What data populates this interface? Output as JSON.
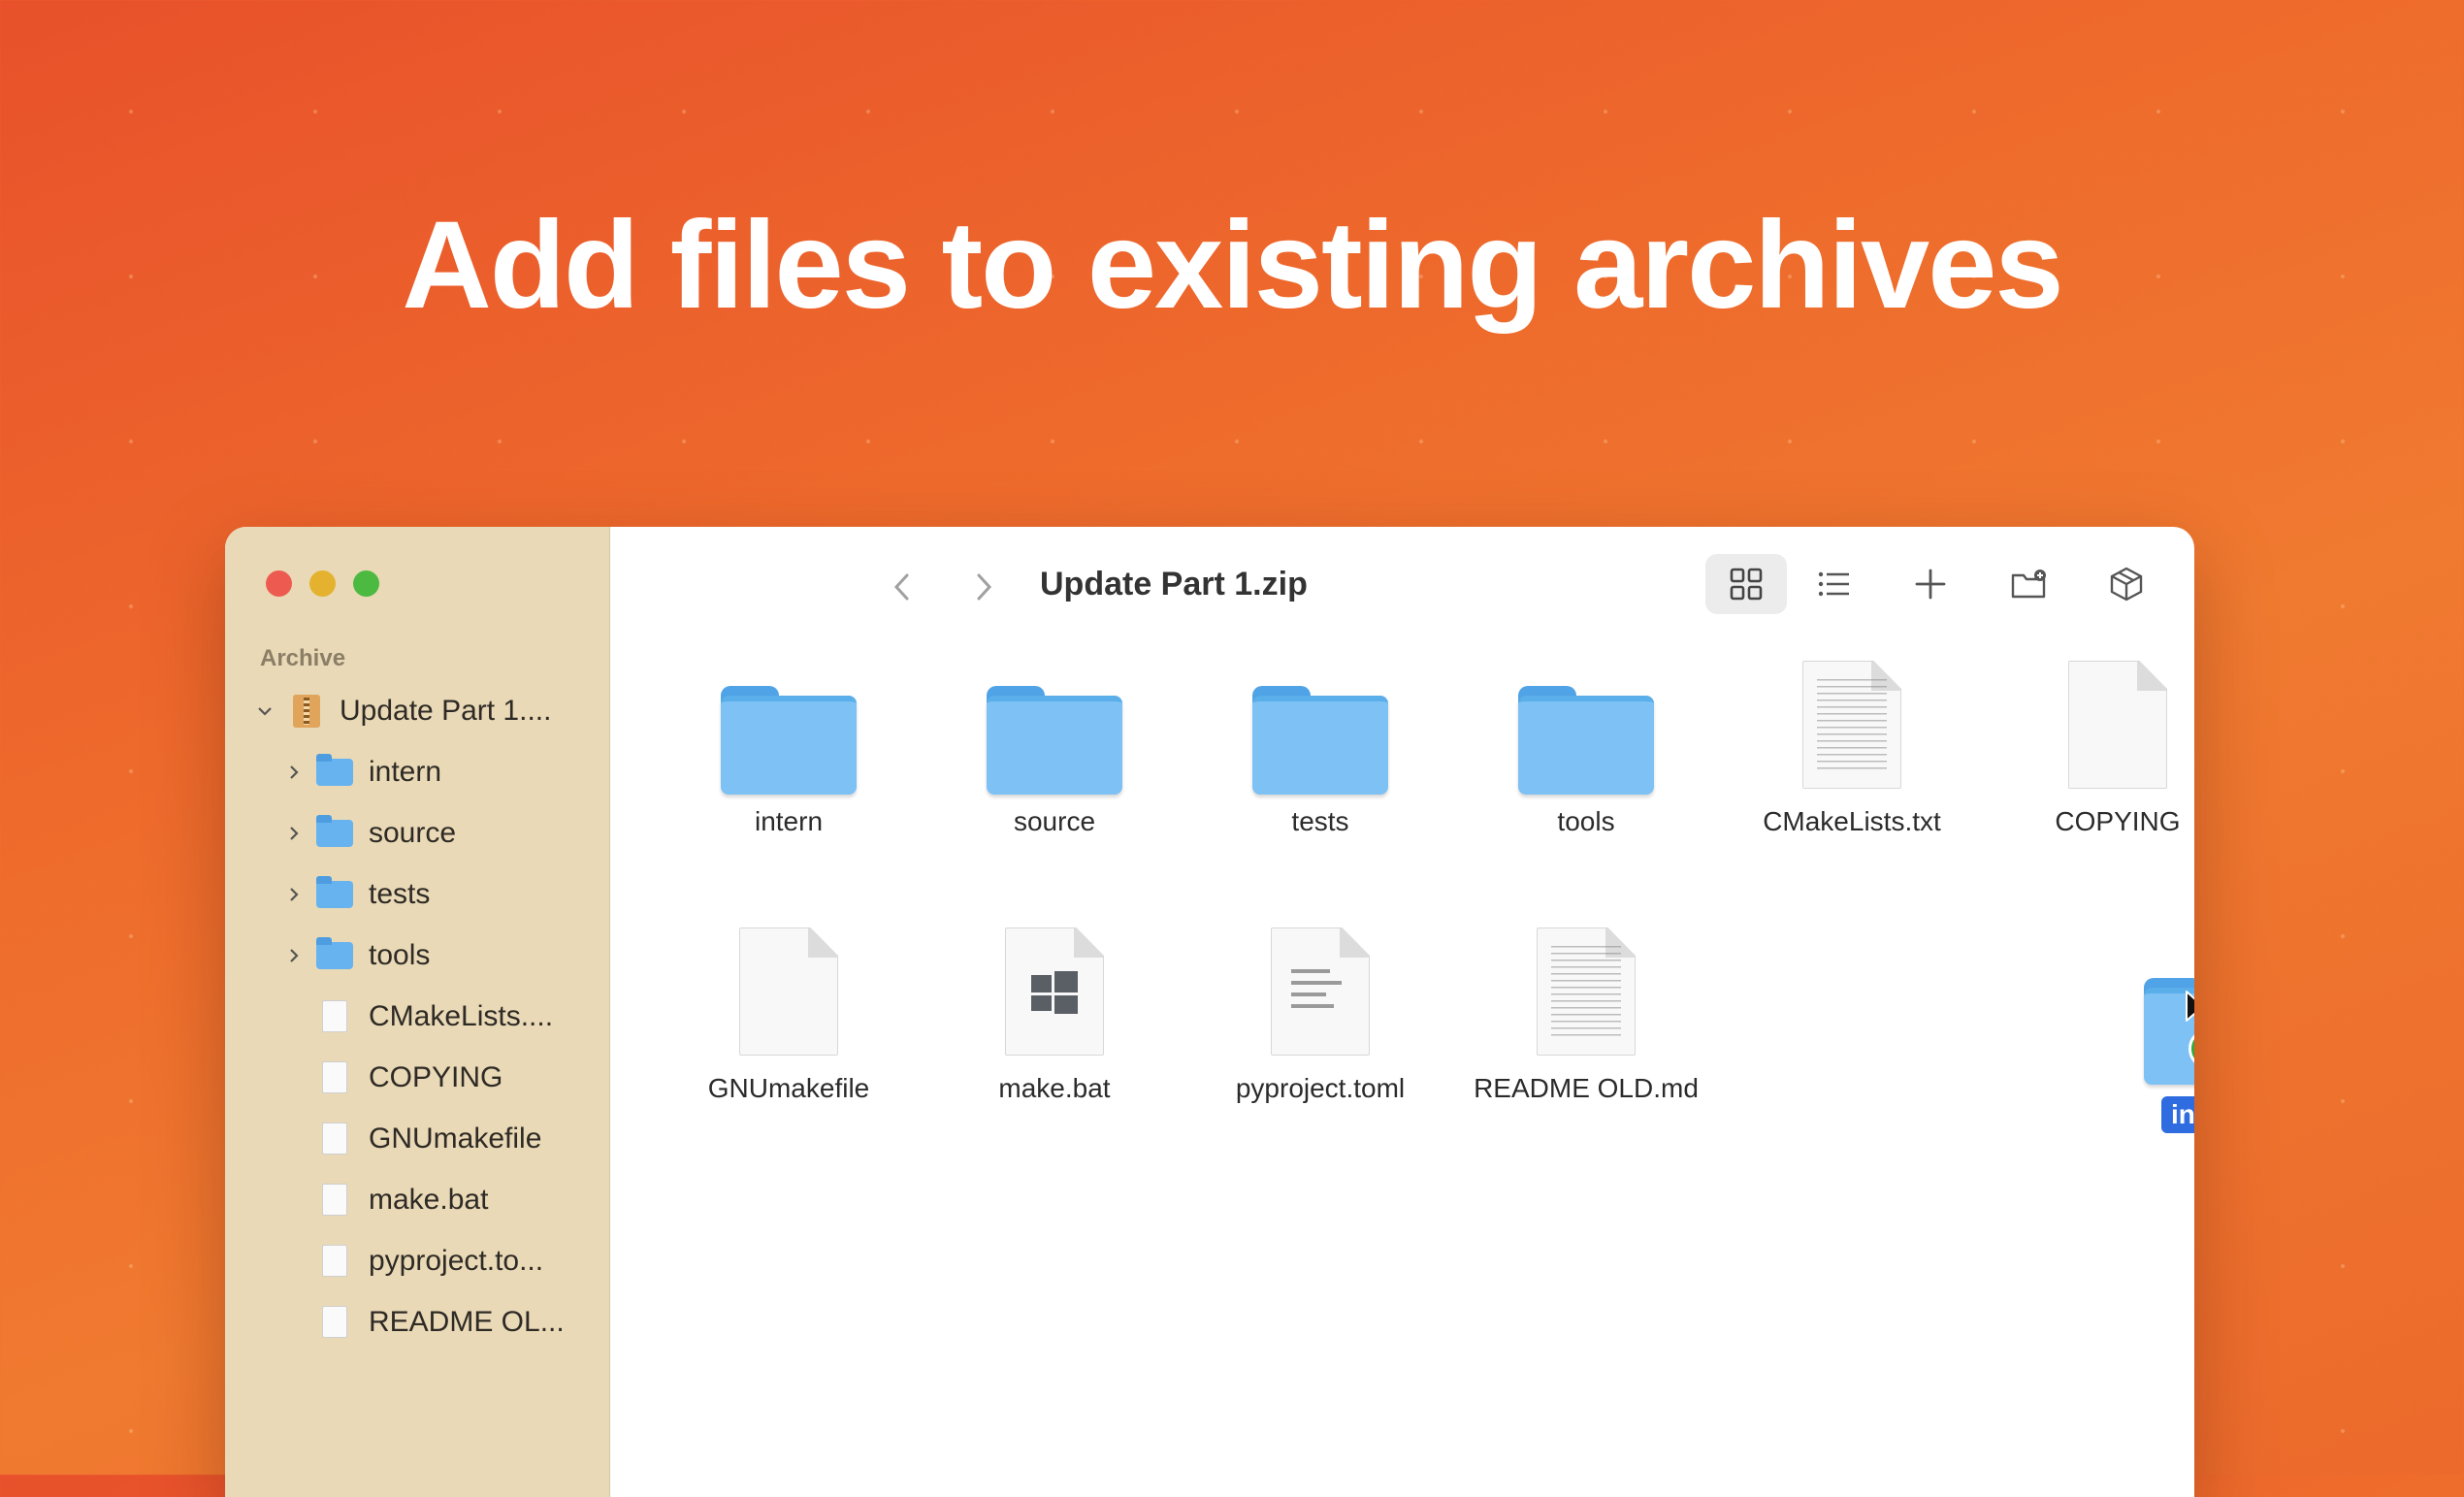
{
  "headline": "Add files to existing archives",
  "window": {
    "title": "Update Part 1.zip"
  },
  "sidebar": {
    "section": "Archive",
    "root": "Update Part 1....",
    "items": [
      {
        "label": "intern",
        "type": "folder"
      },
      {
        "label": "source",
        "type": "folder"
      },
      {
        "label": "tests",
        "type": "folder"
      },
      {
        "label": "tools",
        "type": "folder"
      },
      {
        "label": "CMakeLists....",
        "type": "file"
      },
      {
        "label": "COPYING",
        "type": "file"
      },
      {
        "label": "GNUmakefile",
        "type": "file"
      },
      {
        "label": "make.bat",
        "type": "file"
      },
      {
        "label": "pyproject.to...",
        "type": "file"
      },
      {
        "label": "README OL...",
        "type": "file"
      }
    ]
  },
  "grid": {
    "row1": [
      "intern",
      "source",
      "tests",
      "tools",
      "CMakeLists.txt",
      "COPYING"
    ],
    "row2": [
      "GNUmakefile",
      "make.bat",
      "pyproject.toml",
      "README OLD.md"
    ]
  },
  "drag": {
    "label": "intern"
  },
  "icons": {
    "back": "chevron-left-icon",
    "forward": "chevron-right-icon",
    "grid": "grid-view-icon",
    "list": "list-view-icon",
    "add": "plus-icon",
    "new_folder": "new-folder-icon",
    "extract": "package-icon",
    "share": "share-icon",
    "search": "search-icon"
  },
  "colors": {
    "accent": "#2f6ce0",
    "folder": "#7ec1f4",
    "sidebar_bg": "#e9d9b6"
  }
}
